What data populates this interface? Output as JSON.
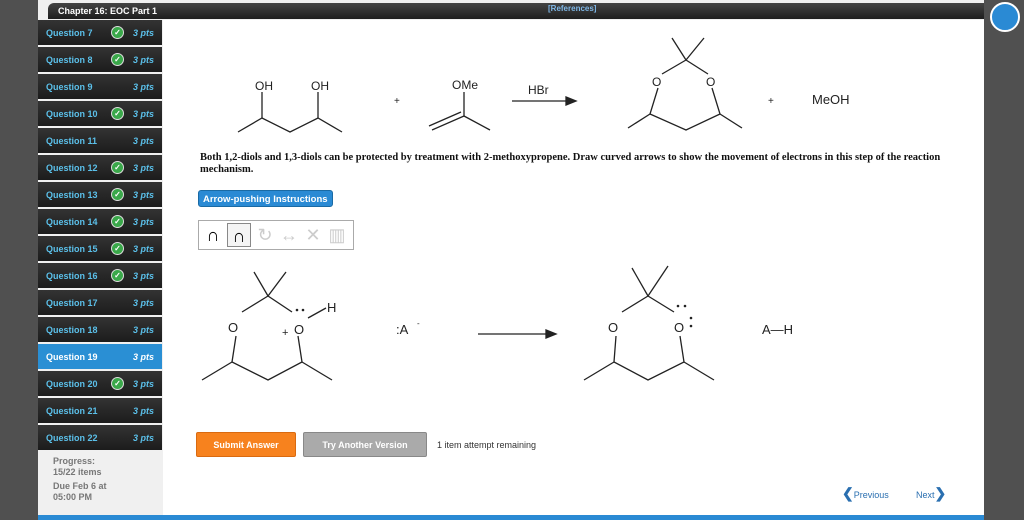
{
  "header": {
    "chapter": "Chapter 16: EOC Part 1",
    "references": "[References]"
  },
  "sidebar": {
    "items": [
      {
        "label": "Question 7",
        "pts": "3 pts",
        "done": true
      },
      {
        "label": "Question 8",
        "pts": "3 pts",
        "done": true
      },
      {
        "label": "Question 9",
        "pts": "3 pts",
        "done": false
      },
      {
        "label": "Question 10",
        "pts": "3 pts",
        "done": true
      },
      {
        "label": "Question 11",
        "pts": "3 pts",
        "done": false
      },
      {
        "label": "Question 12",
        "pts": "3 pts",
        "done": true
      },
      {
        "label": "Question 13",
        "pts": "3 pts",
        "done": true
      },
      {
        "label": "Question 14",
        "pts": "3 pts",
        "done": true
      },
      {
        "label": "Question 15",
        "pts": "3 pts",
        "done": true
      },
      {
        "label": "Question 16",
        "pts": "3 pts",
        "done": true
      },
      {
        "label": "Question 17",
        "pts": "3 pts",
        "done": false
      },
      {
        "label": "Question 18",
        "pts": "3 pts",
        "done": false
      },
      {
        "label": "Question 19",
        "pts": "3 pts",
        "done": false,
        "active": true
      },
      {
        "label": "Question 20",
        "pts": "3 pts",
        "done": true
      },
      {
        "label": "Question 21",
        "pts": "3 pts",
        "done": false
      },
      {
        "label": "Question 22",
        "pts": "3 pts",
        "done": false
      }
    ],
    "progress_label": "Progress:",
    "progress": "15/22 items",
    "due_line1": "Due Feb 6 at",
    "due_line2": "05:00 PM"
  },
  "reaction": {
    "oh1": "OH",
    "oh2": "OH",
    "plus1": "+",
    "ome": "OMe",
    "reagent": "HBr",
    "o1": "O",
    "o2": "O",
    "plus2": "+",
    "meoh": "MeOH"
  },
  "question": "Both 1,2-diols and 1,3-diols can be protected by treatment with 2-methoxypropene. Draw curved arrows to show the movement of electrons in this step of the reaction mechanism.",
  "arrow_pushing_label": "Arrow-pushing Instructions",
  "mechanism": {
    "o_left": "O",
    "o_plus": "O",
    "plus": "+",
    "h": "H",
    "base": ":A",
    "base_charge": "-",
    "o_r1": "O",
    "o_r2": "O",
    "ah": "A—H"
  },
  "buttons": {
    "submit": "Submit Answer",
    "another": "Try Another Version",
    "remaining": "1 item attempt remaining",
    "previous": "Previous",
    "next": "Next"
  }
}
